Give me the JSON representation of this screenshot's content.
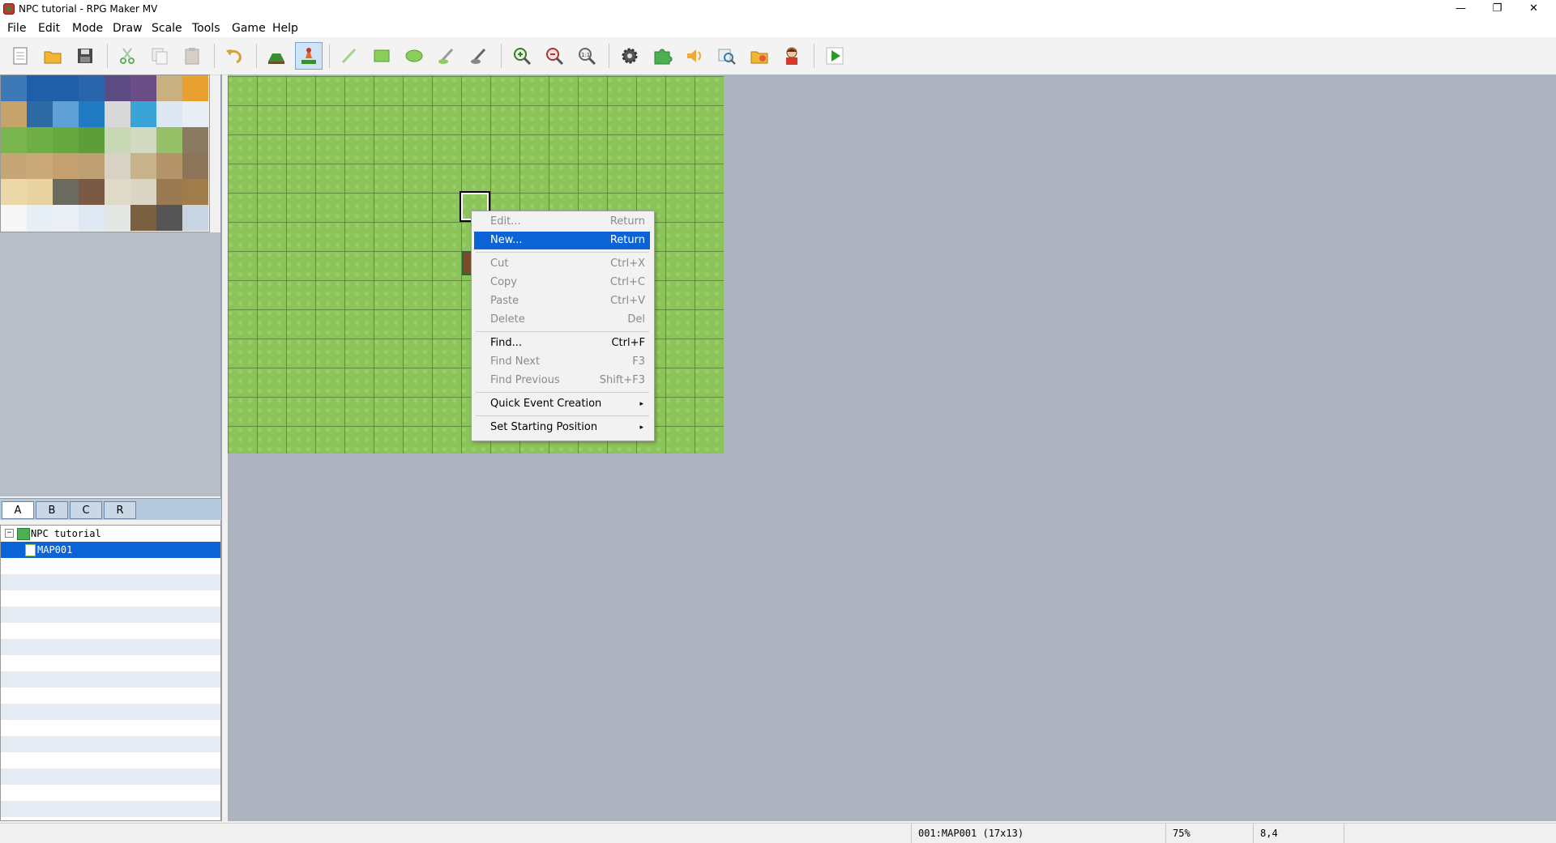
{
  "window": {
    "title": "NPC tutorial - RPG Maker MV",
    "minimize": "—",
    "restore": "❐",
    "close": "✕"
  },
  "menubar": [
    "File",
    "Edit",
    "Mode",
    "Draw",
    "Scale",
    "Tools",
    "Game",
    "Help"
  ],
  "toolbar": {
    "buttons": [
      {
        "name": "new-project-icon"
      },
      {
        "name": "open-project-icon"
      },
      {
        "name": "save-project-icon"
      },
      {
        "name": "cut-icon"
      },
      {
        "name": "copy-icon"
      },
      {
        "name": "paste-icon"
      },
      {
        "name": "undo-icon"
      },
      {
        "name": "map-mode-icon"
      },
      {
        "name": "event-mode-icon",
        "active": true
      },
      {
        "name": "pencil-icon"
      },
      {
        "name": "rectangle-icon"
      },
      {
        "name": "ellipse-icon"
      },
      {
        "name": "flood-fill-icon"
      },
      {
        "name": "shadow-pen-icon"
      },
      {
        "name": "zoom-in-icon"
      },
      {
        "name": "zoom-out-icon"
      },
      {
        "name": "actual-size-icon"
      },
      {
        "name": "database-icon"
      },
      {
        "name": "plugin-manager-icon"
      },
      {
        "name": "sound-test-icon"
      },
      {
        "name": "event-searcher-icon"
      },
      {
        "name": "resource-manager-icon"
      },
      {
        "name": "character-generator-icon"
      },
      {
        "name": "playtest-icon"
      }
    ]
  },
  "tileset": {
    "tabs": [
      "A",
      "B",
      "C",
      "R"
    ],
    "active_tab": "A"
  },
  "map_tree": {
    "project": "NPC tutorial",
    "maps": [
      "MAP001"
    ],
    "selected": "MAP001"
  },
  "context_menu": {
    "items": [
      {
        "label": "Edit...",
        "shortcut": "Return",
        "disabled": true
      },
      {
        "label": "New...",
        "shortcut": "Return",
        "highlighted": true
      },
      {
        "separator": true
      },
      {
        "label": "Cut",
        "shortcut": "Ctrl+X",
        "disabled": true
      },
      {
        "label": "Copy",
        "shortcut": "Ctrl+C",
        "disabled": true
      },
      {
        "label": "Paste",
        "shortcut": "Ctrl+V",
        "disabled": true
      },
      {
        "label": "Delete",
        "shortcut": "Del",
        "disabled": true
      },
      {
        "separator": true
      },
      {
        "label": "Find...",
        "shortcut": "Ctrl+F"
      },
      {
        "label": "Find Next",
        "shortcut": "F3",
        "disabled": true
      },
      {
        "label": "Find Previous",
        "shortcut": "Shift+F3",
        "disabled": true
      },
      {
        "separator": true
      },
      {
        "label": "Quick Event Creation",
        "submenu": true
      },
      {
        "separator": true
      },
      {
        "label": "Set Starting Position",
        "submenu": true
      }
    ]
  },
  "statusbar": {
    "map": "001:MAP001 (17x13)",
    "zoom": "75%",
    "coords": "8,4"
  }
}
